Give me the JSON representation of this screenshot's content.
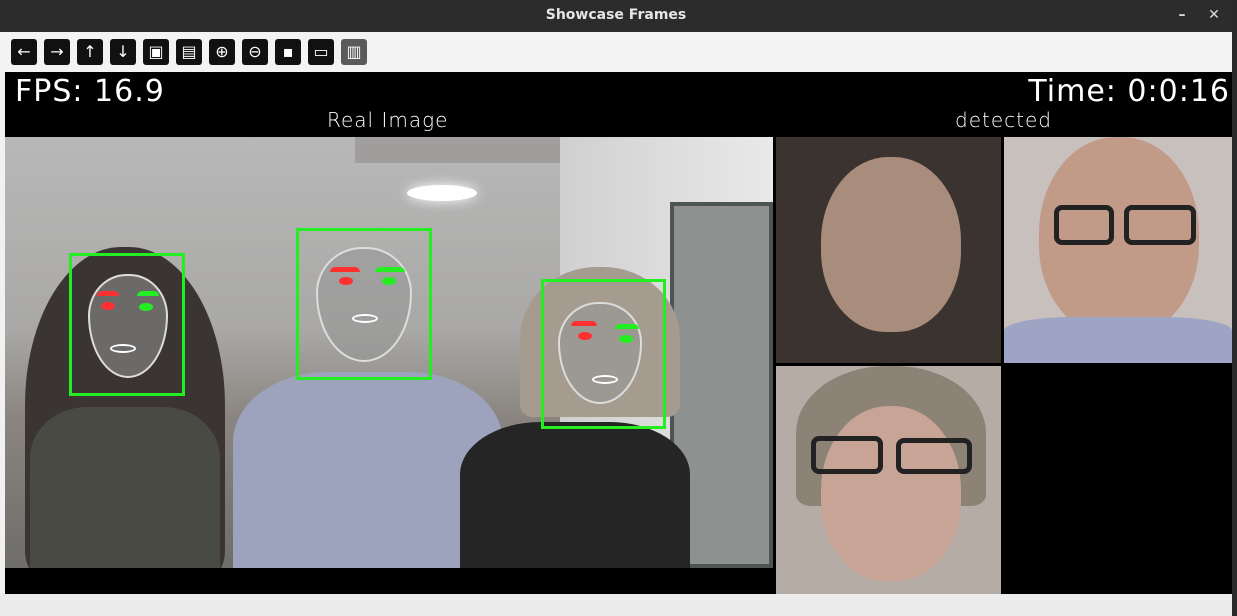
{
  "window": {
    "title": "Showcase Frames"
  },
  "toolbar": {
    "buttons": [
      {
        "name": "back-button",
        "icon": "arrow-left-icon",
        "glyph": "←"
      },
      {
        "name": "forward-button",
        "icon": "arrow-right-icon",
        "glyph": "→"
      },
      {
        "name": "up-button",
        "icon": "arrow-up-icon",
        "glyph": "↑"
      },
      {
        "name": "down-button",
        "icon": "arrow-down-icon",
        "glyph": "↓"
      },
      {
        "name": "image-button",
        "icon": "image-icon",
        "glyph": "▣"
      },
      {
        "name": "image-settings-button",
        "icon": "image-settings-icon",
        "glyph": "▤"
      },
      {
        "name": "zoom-in-button",
        "icon": "zoom-in-icon",
        "glyph": "⊕"
      },
      {
        "name": "zoom-out-button",
        "icon": "zoom-out-icon",
        "glyph": "⊖"
      },
      {
        "name": "save-button",
        "icon": "save-icon",
        "glyph": "▪"
      },
      {
        "name": "copy-button",
        "icon": "clipboard-icon",
        "glyph": "▭"
      },
      {
        "name": "properties-button",
        "icon": "properties-icon",
        "glyph": "▥"
      }
    ]
  },
  "overlay": {
    "fps_text": "FPS: 16.9",
    "time_text": "Time: 0:0:16",
    "real_label": "Real Image",
    "detected_label": "detected"
  },
  "colors": {
    "box_green": "#22ee22",
    "eye_red": "#ff3030",
    "eye_green": "#22ee22"
  }
}
